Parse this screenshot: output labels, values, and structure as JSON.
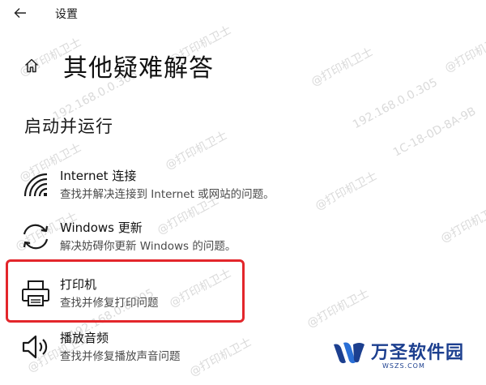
{
  "window": {
    "title": "设置"
  },
  "page": {
    "title": "其他疑难解答"
  },
  "section": {
    "title": "启动并运行"
  },
  "items": [
    {
      "label": "Internet 连接",
      "desc": "查找并解决连接到 Internet 或网站的问题。",
      "icon": "wifi-icon"
    },
    {
      "label": "Windows 更新",
      "desc": "解决妨碍你更新 Windows 的问题。",
      "icon": "refresh-icon"
    },
    {
      "label": "打印机",
      "desc": "查找并修复打印问题",
      "icon": "printer-icon"
    },
    {
      "label": "播放音频",
      "desc": "查找并修复播放声音问题",
      "icon": "speaker-icon"
    }
  ],
  "watermark": {
    "text": "@打印机卫士",
    "ip": "192.168.0.0.305",
    "mac": "1C-18-0D-8A-9B"
  },
  "brand": {
    "name": "万圣软件园",
    "url": "WSZS.COM",
    "color": "#1c3f8f"
  },
  "colors": {
    "highlight": "#e3262b"
  }
}
